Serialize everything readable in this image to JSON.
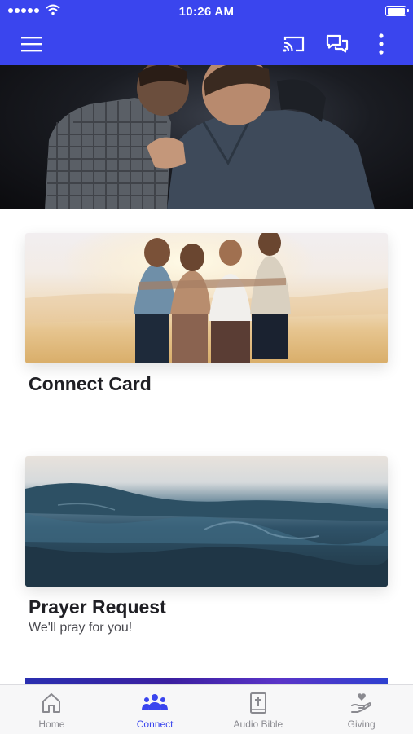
{
  "status_bar": {
    "time": "10:26 AM"
  },
  "app_bar": {
    "icons": {
      "menu": "hamburger-menu-icon",
      "cast": "cast-icon",
      "chat": "chat-icon",
      "more": "more-vert-icon"
    }
  },
  "colors": {
    "primary": "#3a45ee",
    "nav_inactive": "#8a8a90",
    "title_text": "#1f1f24"
  },
  "cards": [
    {
      "title": "Connect Card",
      "subtitle": ""
    },
    {
      "title": "Prayer Request",
      "subtitle": "We'll pray for you!"
    }
  ],
  "bottom_nav": {
    "active": "Connect",
    "items": [
      {
        "label": "Home",
        "icon": "home-icon"
      },
      {
        "label": "Connect",
        "icon": "people-icon"
      },
      {
        "label": "Audio Bible",
        "icon": "bible-icon"
      },
      {
        "label": "Giving",
        "icon": "giving-hand-icon"
      }
    ]
  }
}
